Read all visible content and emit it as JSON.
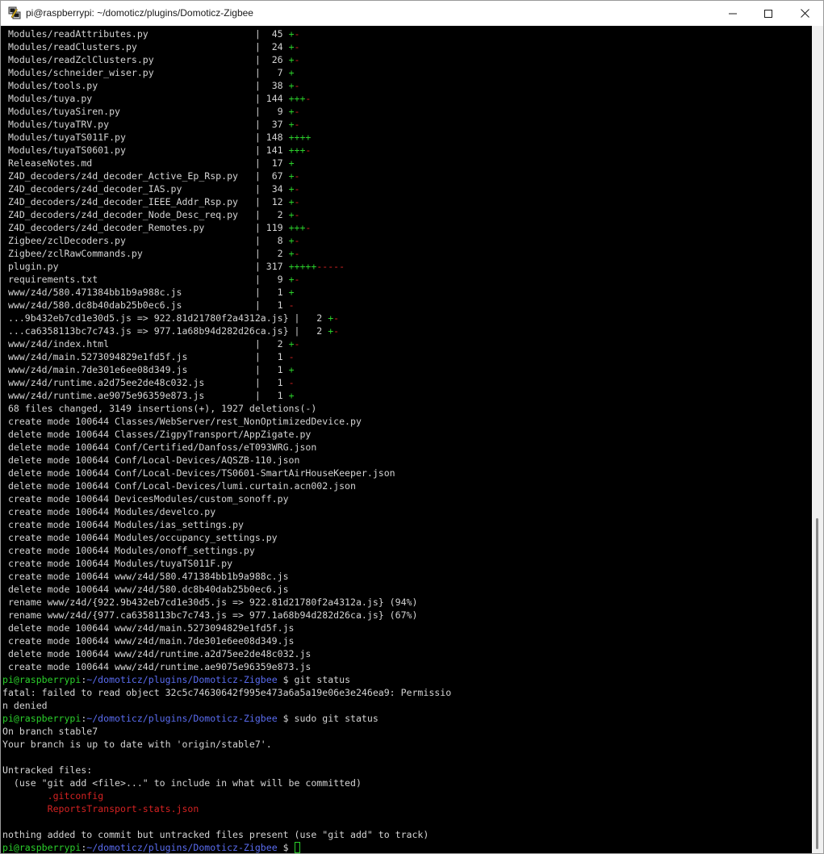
{
  "window": {
    "title": "pi@raspberrypi: ~/domoticz/plugins/Domoticz-Zigbee",
    "icon": "putty-icon",
    "controls": {
      "minimize_icon": "minimize-icon",
      "maximize_icon": "maximize-icon",
      "close_icon": "close-icon"
    }
  },
  "colors": {
    "background": "#000000",
    "text": "#d4d4d4",
    "green": "#2bd02b",
    "red": "#d42222",
    "blue": "#5a6cf0"
  },
  "stat_lines": [
    {
      "file": " Modules/readAttributes.py                   ",
      "count": "  45 ",
      "plus": "+",
      "minus": "-"
    },
    {
      "file": " Modules/readClusters.py                     ",
      "count": "  24 ",
      "plus": "+",
      "minus": "-"
    },
    {
      "file": " Modules/readZclClusters.py                  ",
      "count": "  26 ",
      "plus": "+",
      "minus": "-"
    },
    {
      "file": " Modules/schneider_wiser.py                  ",
      "count": "   7 ",
      "plus": "+",
      "minus": ""
    },
    {
      "file": " Modules/tools.py                            ",
      "count": "  38 ",
      "plus": "+",
      "minus": "-"
    },
    {
      "file": " Modules/tuya.py                             ",
      "count": " 144 ",
      "plus": "+++",
      "minus": "-"
    },
    {
      "file": " Modules/tuyaSiren.py                        ",
      "count": "   9 ",
      "plus": "+",
      "minus": "-"
    },
    {
      "file": " Modules/tuyaTRV.py                          ",
      "count": "  37 ",
      "plus": "+",
      "minus": "-"
    },
    {
      "file": " Modules/tuyaTS011F.py                       ",
      "count": " 148 ",
      "plus": "++++",
      "minus": ""
    },
    {
      "file": " Modules/tuyaTS0601.py                       ",
      "count": " 141 ",
      "plus": "+++",
      "minus": "-"
    },
    {
      "file": " ReleaseNotes.md                             ",
      "count": "  17 ",
      "plus": "+",
      "minus": ""
    },
    {
      "file": " Z4D_decoders/z4d_decoder_Active_Ep_Rsp.py   ",
      "count": "  67 ",
      "plus": "+",
      "minus": "-"
    },
    {
      "file": " Z4D_decoders/z4d_decoder_IAS.py             ",
      "count": "  34 ",
      "plus": "+",
      "minus": "-"
    },
    {
      "file": " Z4D_decoders/z4d_decoder_IEEE_Addr_Rsp.py   ",
      "count": "  12 ",
      "plus": "+",
      "minus": "-"
    },
    {
      "file": " Z4D_decoders/z4d_decoder_Node_Desc_req.py   ",
      "count": "   2 ",
      "plus": "+",
      "minus": "-"
    },
    {
      "file": " Z4D_decoders/z4d_decoder_Remotes.py         ",
      "count": " 119 ",
      "plus": "+++",
      "minus": "-"
    },
    {
      "file": " Zigbee/zclDecoders.py                       ",
      "count": "   8 ",
      "plus": "+",
      "minus": "-"
    },
    {
      "file": " Zigbee/zclRawCommands.py                    ",
      "count": "   2 ",
      "plus": "+",
      "minus": "-"
    },
    {
      "file": " plugin.py                                   ",
      "count": " 317 ",
      "plus": "+++++",
      "minus": "-----"
    },
    {
      "file": " requirements.txt                            ",
      "count": "   9 ",
      "plus": "+",
      "minus": "-"
    },
    {
      "file": " www/z4d/580.471384bb1b9a988c.js             ",
      "count": "   1 ",
      "plus": "+",
      "minus": ""
    },
    {
      "file": " www/z4d/580.dc8b40dab25b0ec6.js             ",
      "count": "   1 ",
      "plus": "",
      "minus": "-"
    },
    {
      "file": " ...9b432eb7cd1e30d5.js => 922.81d21780f2a4312a.js}",
      "sep": " ",
      "count": "   2 ",
      "plus": "+",
      "minus": "-"
    },
    {
      "file": " ...ca6358113bc7c743.js => 977.1a68b94d282d26ca.js}",
      "sep": " ",
      "count": "   2 ",
      "plus": "+",
      "minus": "-"
    },
    {
      "file": " www/z4d/index.html                          ",
      "count": "   2 ",
      "plus": "+",
      "minus": "-"
    },
    {
      "file": " www/z4d/main.5273094829e1fd5f.js            ",
      "count": "   1 ",
      "plus": "",
      "minus": "-"
    },
    {
      "file": " www/z4d/main.7de301e6ee08d349.js            ",
      "count": "   1 ",
      "plus": "+",
      "minus": ""
    },
    {
      "file": " www/z4d/runtime.a2d75ee2de48c032.js         ",
      "count": "   1 ",
      "plus": "",
      "minus": "-"
    },
    {
      "file": " www/z4d/runtime.ae9075e96359e873.js         ",
      "count": "   1 ",
      "plus": "+",
      "minus": ""
    }
  ],
  "summary_line": " 68 files changed, 3149 insertions(+), 1927 deletions(-)",
  "mode_lines": [
    " create mode 100644 Classes/WebServer/rest_NonOptimizedDevice.py",
    " delete mode 100644 Classes/ZigpyTransport/AppZigate.py",
    " delete mode 100644 Conf/Certified/Danfoss/eT093WRG.json",
    " delete mode 100644 Conf/Local-Devices/AQSZB-110.json",
    " delete mode 100644 Conf/Local-Devices/TS0601-SmartAirHouseKeeper.json",
    " delete mode 100644 Conf/Local-Devices/lumi.curtain.acn002.json",
    " create mode 100644 DevicesModules/custom_sonoff.py",
    " create mode 100644 Modules/develco.py",
    " create mode 100644 Modules/ias_settings.py",
    " create mode 100644 Modules/occupancy_settings.py",
    " create mode 100644 Modules/onoff_settings.py",
    " create mode 100644 Modules/tuyaTS011F.py",
    " create mode 100644 www/z4d/580.471384bb1b9a988c.js",
    " delete mode 100644 www/z4d/580.dc8b40dab25b0ec6.js",
    " rename www/z4d/{922.9b432eb7cd1e30d5.js => 922.81d21780f2a4312a.js} (94%)",
    " rename www/z4d/{977.ca6358113bc7c743.js => 977.1a68b94d282d26ca.js} (67%)",
    " delete mode 100644 www/z4d/main.5273094829e1fd5f.js",
    " create mode 100644 www/z4d/main.7de301e6ee08d349.js",
    " delete mode 100644 www/z4d/runtime.a2d75ee2de48c032.js",
    " create mode 100644 www/z4d/runtime.ae9075e96359e873.js"
  ],
  "prompt": {
    "user_host": "pi@raspberrypi",
    "colon": ":",
    "path": "~/domoticz/plugins/Domoticz-Zigbee",
    "symbol": " $ "
  },
  "commands": {
    "first": "git status",
    "second": "sudo git status"
  },
  "error_lines": [
    "fatal: failed to read object 32c5c74630642f995e473a6a5a19e06e3e246ea9: Permissio",
    "n denied"
  ],
  "status_lines": {
    "branch": "On branch stable7",
    "uptodate": "Your branch is up to date with 'origin/stable7'.",
    "untracked_header": "Untracked files:",
    "hint": "  (use \"git add <file>...\" to include in what will be committed)",
    "untracked_files": [
      ".gitconfig",
      "ReportsTransport-stats.json"
    ],
    "nothing": "nothing added to commit but untracked files present (use \"git add\" to track)"
  },
  "scrollbar": {
    "position_fraction": 1.0
  }
}
